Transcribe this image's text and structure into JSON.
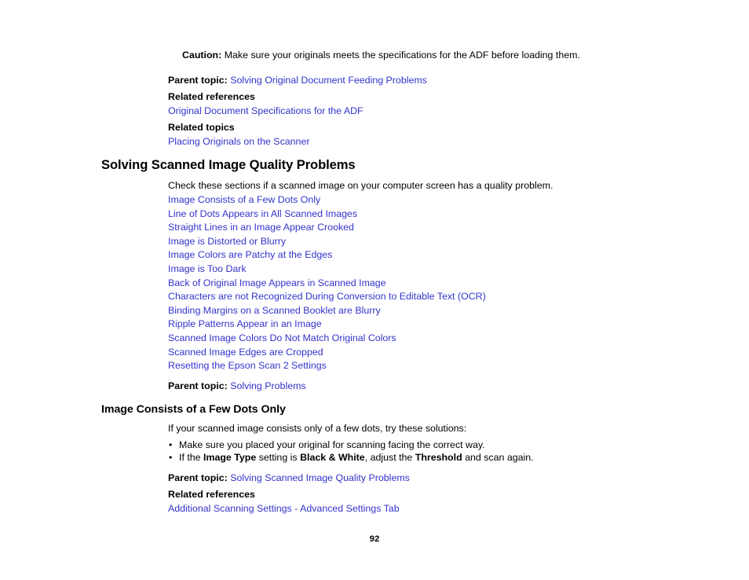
{
  "document": {
    "page_number": "92",
    "link_color": "#3333cc",
    "text_color": "#000000",
    "background_color": "#ffffff"
  },
  "caution": {
    "label": "Caution:",
    "text": "Make sure your originals meets the specifications for the ADF before loading them."
  },
  "block1": {
    "parent_topic_label": "Parent topic:",
    "parent_topic_link": "Solving Original Document Feeding Problems",
    "related_references_label": "Related references",
    "related_references_link": "Original Document Specifications for the ADF",
    "related_topics_label": "Related topics",
    "related_topics_link": "Placing Originals on the Scanner"
  },
  "section": {
    "title": "Solving Scanned Image Quality Problems",
    "intro": "Check these sections if a scanned image on your computer screen has a quality problem.",
    "topic_links": [
      "Image Consists of a Few Dots Only",
      "Line of Dots Appears in All Scanned Images",
      "Straight Lines in an Image Appear Crooked",
      "Image is Distorted or Blurry",
      "Image Colors are Patchy at the Edges",
      "Image is Too Dark",
      "Back of Original Image Appears in Scanned Image",
      "Characters are not Recognized During Conversion to Editable Text (OCR)",
      "Binding Margins on a Scanned Booklet are Blurry",
      "Ripple Patterns Appear in an Image",
      "Scanned Image Colors Do Not Match Original Colors",
      "Scanned Image Edges are Cropped",
      "Resetting the Epson Scan 2 Settings"
    ],
    "parent_topic_label": "Parent topic:",
    "parent_topic_link": "Solving Problems"
  },
  "subsection": {
    "title": "Image Consists of a Few Dots Only",
    "intro": "If your scanned image consists only of a few dots, try these solutions:",
    "bullets": [
      {
        "marker": "•",
        "parts": [
          {
            "text": "Make sure you placed your original for scanning facing the correct way.",
            "bold": false
          }
        ]
      },
      {
        "marker": "•",
        "parts": [
          {
            "text": "If the ",
            "bold": false
          },
          {
            "text": "Image Type",
            "bold": true
          },
          {
            "text": " setting is ",
            "bold": false
          },
          {
            "text": "Black & White",
            "bold": true
          },
          {
            "text": ", adjust the ",
            "bold": false
          },
          {
            "text": "Threshold",
            "bold": true
          },
          {
            "text": " and scan again.",
            "bold": false
          }
        ]
      }
    ],
    "parent_topic_label": "Parent topic:",
    "parent_topic_link": "Solving Scanned Image Quality Problems",
    "related_references_label": "Related references",
    "related_references_link": "Additional Scanning Settings - Advanced Settings Tab"
  }
}
